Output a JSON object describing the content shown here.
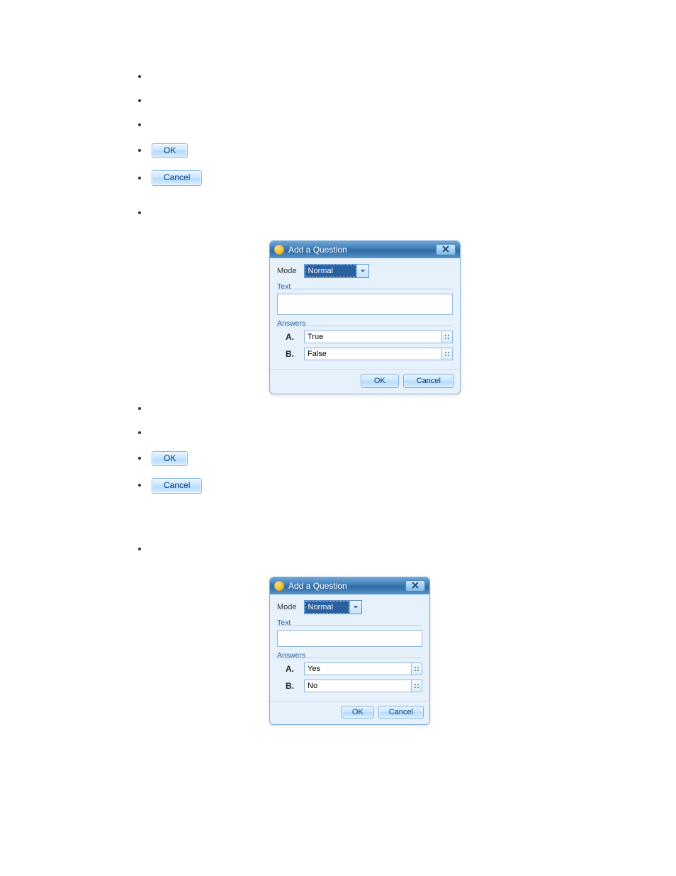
{
  "section1": {
    "bullets": [
      "",
      "",
      "",
      {
        "prefix": "",
        "button": "OK",
        "suffix": ""
      },
      {
        "prefix": "",
        "button": "Cancel",
        "suffix": ""
      }
    ]
  },
  "section2": {
    "intro_bullet": "",
    "dialog": {
      "title": "Add a Question",
      "mode_label": "Mode",
      "mode_value": "Normal",
      "text_label": "Text",
      "text_value": "",
      "answers_label": "Answers",
      "answers": [
        {
          "letter": "A.",
          "value": "True"
        },
        {
          "letter": "B.",
          "value": "False"
        }
      ],
      "ok": "OK",
      "cancel": "Cancel"
    },
    "bullets_after": [
      "",
      "",
      {
        "prefix": "",
        "button": "OK",
        "suffix": ""
      },
      {
        "prefix": "",
        "button": "Cancel",
        "suffix": ""
      }
    ]
  },
  "section3": {
    "intro_bullet": "",
    "dialog": {
      "title": "Add a Question",
      "mode_label": "Mode",
      "mode_value": "Normal",
      "text_label": "Text",
      "text_value": "",
      "answers_label": "Answers",
      "answers": [
        {
          "letter": "A.",
          "value": "Yes"
        },
        {
          "letter": "B.",
          "value": "No"
        }
      ],
      "ok": "OK",
      "cancel": "Cancel"
    }
  },
  "footer_link": ""
}
